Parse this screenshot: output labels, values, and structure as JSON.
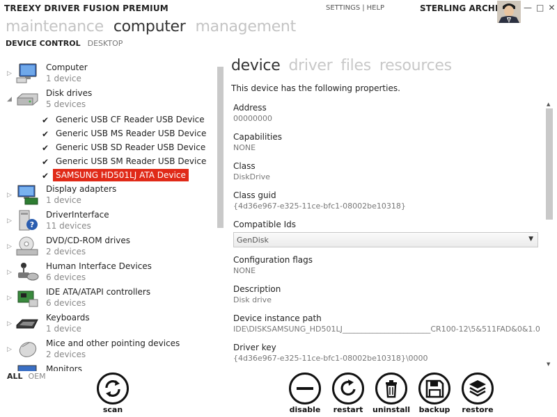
{
  "app": {
    "title": "TREEXY DRIVER FUSION PREMIUM",
    "links": {
      "settings": "SETTINGS",
      "separator": "|",
      "help": "HELP"
    },
    "user": "STERLING ARCHER",
    "window": {
      "minimize": "—",
      "maximize": "□",
      "close": "✕"
    }
  },
  "nav": {
    "main": [
      "maintenance",
      "computer",
      "management"
    ],
    "main_active": "computer",
    "sub": [
      "DEVICE CONTROL",
      "DESKTOP"
    ],
    "sub_active": "DEVICE CONTROL"
  },
  "tree": {
    "nodes": [
      {
        "name": "Computer",
        "count": "1 device",
        "icon": "computer-icon"
      },
      {
        "name": "Disk drives",
        "count": "5 devices",
        "icon": "disk-drive-icon",
        "expanded": true,
        "children": [
          {
            "label": "Generic USB CF Reader USB Device",
            "checked": true
          },
          {
            "label": "Generic USB MS Reader USB Device",
            "checked": true
          },
          {
            "label": "Generic USB SD Reader USB Device",
            "checked": true
          },
          {
            "label": "Generic USB SM Reader USB Device",
            "checked": true
          },
          {
            "label": "SAMSUNG HD501LJ ATA Device",
            "checked": true,
            "selected": true
          }
        ]
      },
      {
        "name": "Display adapters",
        "count": "1 device",
        "icon": "display-adapter-icon"
      },
      {
        "name": "DriverInterface",
        "count": "11 devices",
        "icon": "driver-interface-icon"
      },
      {
        "name": "DVD/CD-ROM drives",
        "count": "2 devices",
        "icon": "dvd-drive-icon"
      },
      {
        "name": "Human Interface Devices",
        "count": "6 devices",
        "icon": "joystick-icon"
      },
      {
        "name": "IDE ATA/ATAPI controllers",
        "count": "6 devices",
        "icon": "ide-controller-icon"
      },
      {
        "name": "Keyboards",
        "count": "1 device",
        "icon": "keyboard-icon"
      },
      {
        "name": "Mice and other pointing devices",
        "count": "2 devices",
        "icon": "mouse-icon"
      },
      {
        "name": "Monitors",
        "count": "",
        "icon": "monitor-icon"
      }
    ]
  },
  "filter": {
    "all": "ALL",
    "oem": "OEM"
  },
  "detail": {
    "tabs": [
      "device",
      "driver",
      "files",
      "resources"
    ],
    "tab_active": "device",
    "intro": "This device has the following properties.",
    "properties": [
      {
        "label": "Address",
        "value": "00000000"
      },
      {
        "label": "Capabilities",
        "value": "NONE"
      },
      {
        "label": "Class",
        "value": "DiskDrive"
      },
      {
        "label": "Class guid",
        "value": "{4d36e967-e325-11ce-bfc1-08002be10318}"
      },
      {
        "label": "Compatible Ids",
        "value": "GenDisk",
        "type": "select"
      },
      {
        "label": "Configuration flags",
        "value": "NONE"
      },
      {
        "label": "Description",
        "value": "Disk drive"
      },
      {
        "label": "Device instance path",
        "value": "IDE\\DISKSAMSUNG_HD501LJ_______________________CR100-12\\5&511FAD&0&1.0.0"
      },
      {
        "label": "Driver key",
        "value": "{4d36e967-e325-11ce-bfc1-08002be10318}\\0000"
      }
    ]
  },
  "actions": {
    "scan": "scan",
    "disable": "disable",
    "restart": "restart",
    "uninstall": "uninstall",
    "backup": "backup",
    "restore": "restore"
  },
  "colors": {
    "accent": "#e02a18",
    "muted": "#c4c4c4"
  }
}
